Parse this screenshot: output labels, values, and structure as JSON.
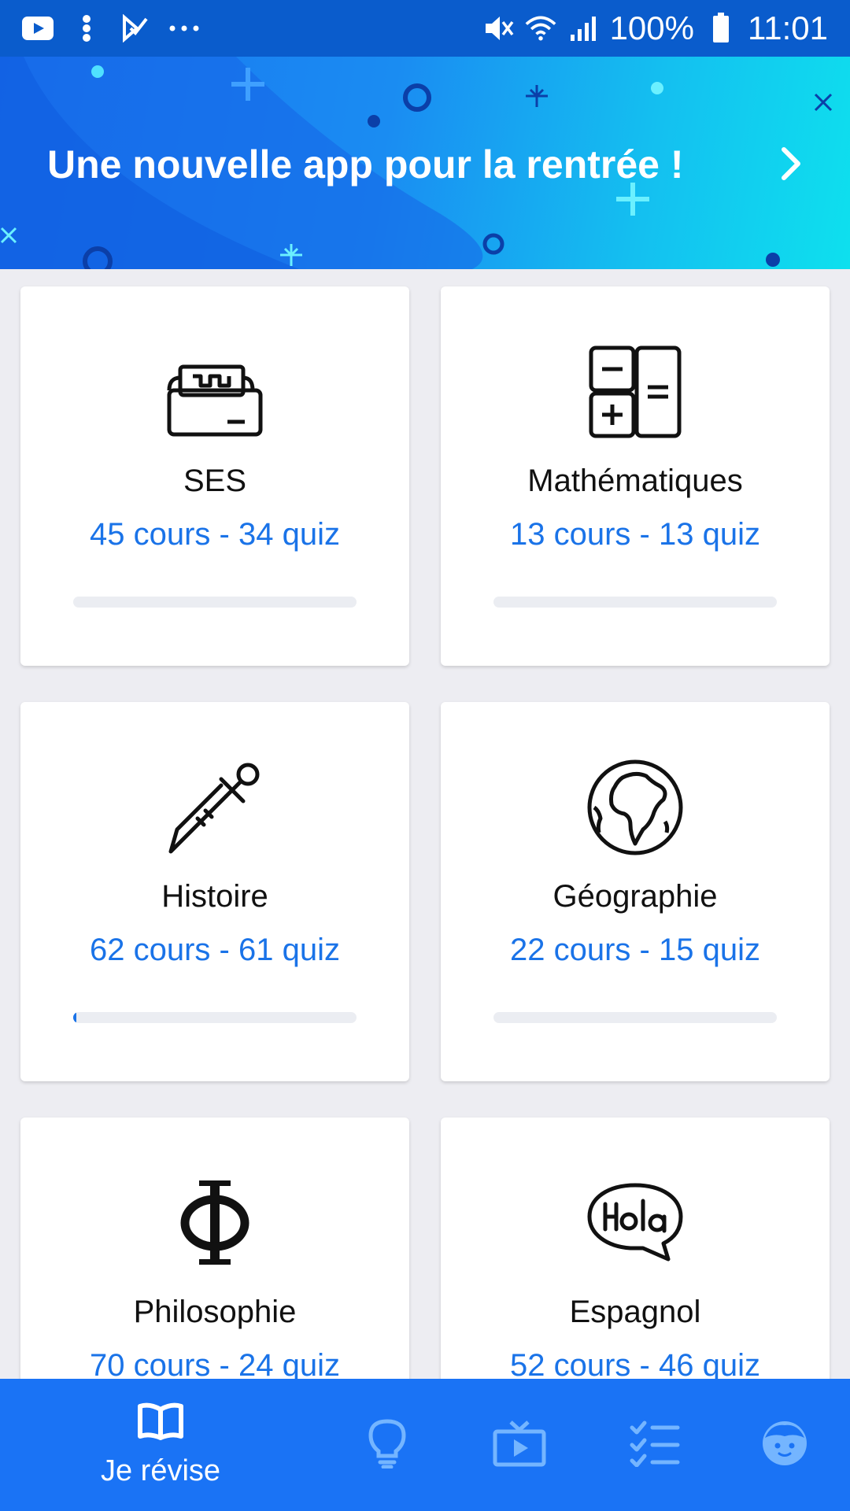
{
  "status_bar": {
    "battery": "100%",
    "time": "11:01",
    "left_icons": [
      "youtube-icon",
      "notification-dots-icon",
      "task-check-icon",
      "more-icon"
    ],
    "right_icons": [
      "mute-icon",
      "wifi-icon",
      "signal-icon",
      "battery-icon"
    ]
  },
  "banner": {
    "text": "Une nouvelle app pour la rentrée !",
    "icon": "chevron-right-icon"
  },
  "subjects": [
    {
      "title": "SES",
      "stats": "45 cours - 34 quiz",
      "icon": "cash-register-icon",
      "progress": 0
    },
    {
      "title": "Mathématiques",
      "stats": "13 cours - 13 quiz",
      "icon": "calculator-icon",
      "progress": 0
    },
    {
      "title": "Histoire",
      "stats": "62 cours - 61 quiz",
      "icon": "sword-icon",
      "progress": 0.01
    },
    {
      "title": "Géographie",
      "stats": "22 cours - 15 quiz",
      "icon": "globe-icon",
      "progress": 0
    },
    {
      "title": "Philosophie",
      "stats": "70 cours - 24 quiz",
      "icon": "phi-icon",
      "progress": 0
    },
    {
      "title": "Espagnol",
      "stats": "52 cours - 46 quiz",
      "icon": "hola-bubble-icon",
      "progress": 0
    }
  ],
  "bottom_nav": {
    "active_label": "Je révise",
    "items": [
      "book-icon",
      "lightbulb-icon",
      "video-icon",
      "checklist-icon",
      "profile-face-icon"
    ]
  },
  "colors": {
    "status_bar": "#0a5ccc",
    "accent": "#1a73e8",
    "nav_bg": "#1a73f5",
    "background": "#ededf2"
  }
}
